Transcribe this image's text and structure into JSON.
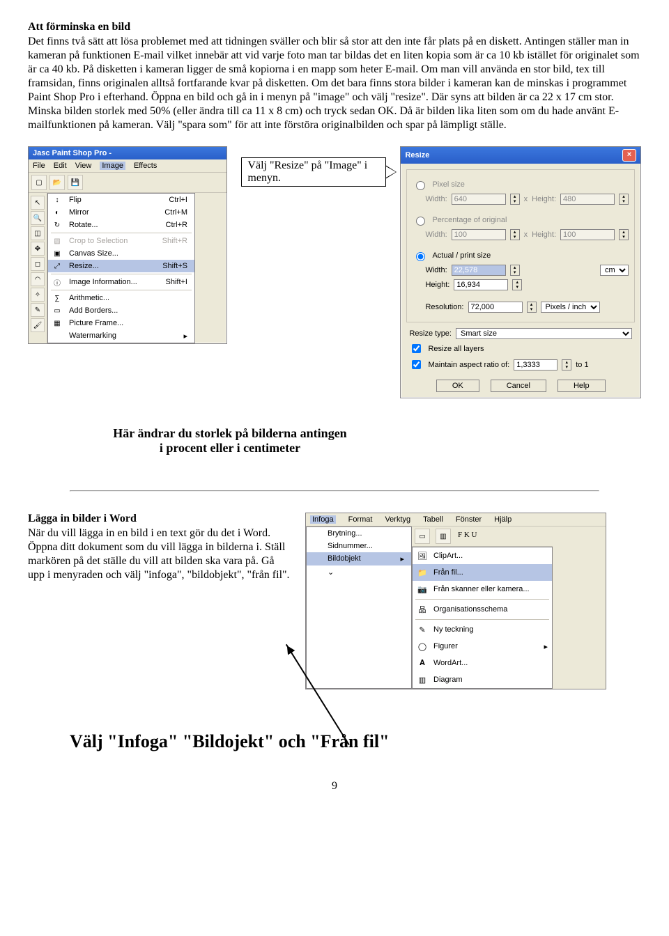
{
  "doc": {
    "heading": "Att förminska en bild",
    "para1": "Det finns två sätt att lösa problemet med att tidningen sväller och blir så stor att den inte får plats på en diskett. Antingen ställer man in kameran på funktionen E-mail vilket innebär att vid varje foto man tar bildas det en liten kopia som är ca 10 kb istället för originalet som är ca 40 kb. På disketten i kameran ligger de små kopiorna i en mapp som heter E-mail. Om man vill använda en stor bild, tex till framsidan, finns originalen alltså fortfarande kvar på disketten. Om det bara finns stora bilder i kameran kan de minskas i programmet Paint Shop Pro i efterhand. Öppna en bild och gå in i menyn på \"image\" och välj \"resize\". Där syns att bilden är ca 22 x 17 cm stor. Minska bilden storlek med 50% (eller ändra till ca 11 x 8 cm) och tryck sedan OK. Då är bilden lika liten som om du hade använt E-mailfunktionen på kameran. Välj \"spara som\" för att inte förstöra originalbilden och spar på lämpligt ställe.",
    "callout_arrow": "Välj \"Resize\" på \"Image\" i menyn.",
    "callout_bold": "Här ändrar du storlek på bilderna antingen i procent eller i centimeter",
    "heading2": "Lägga in bilder i Word",
    "para2": "När du vill lägga in en bild i en text gör du det i Word. Öppna ditt dokument som du vill lägga in bilderna i. Ställ markören på det ställe du vill att bilden ska vara på. Gå upp i menyraden och välj \"infoga\", \"bildobjekt\", \"från fil\".",
    "callout_big": "Välj \"Infoga\" \"Bildojekt\" och \"Från fil\"",
    "page": "9"
  },
  "psp": {
    "title": "Jasc Paint Shop Pro -",
    "menus": [
      "File",
      "Edit",
      "View",
      "Image",
      "Effects"
    ],
    "dropdown": [
      {
        "ico": "↕",
        "label": "Flip",
        "sc": "Ctrl+I"
      },
      {
        "ico": "◐",
        "label": "Mirror",
        "sc": "Ctrl+M"
      },
      {
        "ico": "↻",
        "label": "Rotate...",
        "sc": "Ctrl+R"
      },
      {
        "ico": "▧",
        "label": "Crop to Selection",
        "sc": "Shift+R",
        "dis": true
      },
      {
        "ico": "▣",
        "label": "Canvas Size...",
        "sc": ""
      },
      {
        "ico": "⤢",
        "label": "Resize...",
        "sc": "Shift+S",
        "sel": true
      },
      {
        "ico": "ⓘ",
        "label": "Image Information...",
        "sc": "Shift+I"
      },
      {
        "ico": "∑",
        "label": "Arithmetic...",
        "sc": ""
      },
      {
        "ico": "▭",
        "label": "Add Borders...",
        "sc": ""
      },
      {
        "ico": "▦",
        "label": "Picture Frame...",
        "sc": ""
      },
      {
        "ico": "",
        "label": "Watermarking",
        "sc": "▸"
      }
    ]
  },
  "resize": {
    "title": "Resize",
    "r1": "Pixel size",
    "r1_w": "640",
    "r1_h": "480",
    "r2": "Percentage of original",
    "r2_w": "100",
    "r2_h": "100",
    "r3": "Actual / print size",
    "r3_w": "22,578",
    "r3_h": "16,934",
    "unit": "cm",
    "res_lbl": "Resolution:",
    "res_v": "72,000",
    "res_u": "Pixels / inch",
    "rt_lbl": "Resize type:",
    "rt_v": "Smart size",
    "c1": "Resize all layers",
    "c2": "Maintain aspect ratio of:",
    "ratio": "1,3333",
    "to1": "to 1",
    "w_lbl": "Width:",
    "h_lbl": "Height:",
    "x": "x",
    "h2": "Height:",
    "ok": "OK",
    "cancel": "Cancel",
    "help": "Help"
  },
  "word": {
    "menus": [
      "Infoga",
      "Format",
      "Verktyg",
      "Tabell",
      "Fönster",
      "Hjälp"
    ],
    "drop": [
      {
        "label": "Brytning..."
      },
      {
        "label": "Sidnummer..."
      },
      {
        "label": "Bildobjekt",
        "sel": true,
        "arrow": "▸"
      },
      {
        "label": "⌄",
        "expand": true
      }
    ],
    "sub": [
      {
        "ico": "🖼",
        "label": "ClipArt..."
      },
      {
        "ico": "📁",
        "label": "Från fil...",
        "sel": true
      },
      {
        "ico": "📷",
        "label": "Från skanner eller kamera..."
      },
      {
        "ico": "品",
        "label": "Organisationsschema"
      },
      {
        "ico": "✎",
        "label": "Ny teckning"
      },
      {
        "ico": "◯",
        "label": "Figurer",
        "arrow": "▸"
      },
      {
        "ico": "𝐀",
        "label": "WordArt..."
      },
      {
        "ico": "▥",
        "label": "Diagram"
      }
    ],
    "tb_fku": "F  K  U"
  }
}
